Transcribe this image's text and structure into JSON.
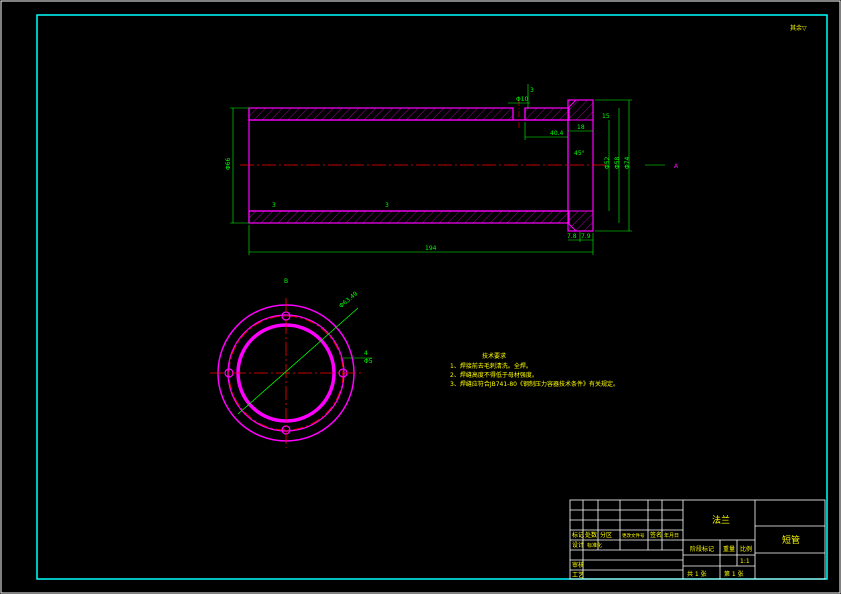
{
  "roughness_symbol": "其余▽",
  "section_label": "A",
  "dimensions": {
    "phi10": "Φ10",
    "small_3": "3",
    "d40_4": "40.4",
    "d18": "18",
    "d15": "15",
    "phi66": "Φ66",
    "phi52": "Φ52",
    "phi58": "Φ58",
    "phi74": "Φ74",
    "chamfer": "45°",
    "weld_a": "3",
    "weld_b": "3",
    "d194": "194",
    "d7_8": "7.8",
    "d7_9": "7.9",
    "circle_b": "B",
    "phi63_49": "Φ63.49",
    "side_4": "4",
    "side_phi5": "Φ5"
  },
  "tech_notes": {
    "title": "技术要求",
    "items": [
      "1、焊接前去毛刺清洗。全焊。",
      "2、焊缝高度不得低于母材强度。",
      "3、焊缝应符合JB741-80《钢制压力容器技术条件》有关规定。"
    ]
  },
  "title_block": {
    "part_name": "法兰",
    "drawing_name": "短管",
    "row_labels": [
      "标记",
      "处数",
      "分区",
      "更改文件号",
      "签名",
      "年月日"
    ],
    "designer": "设计",
    "standardize": "标准化",
    "audit": "审核",
    "process": "工艺",
    "approve": "批准",
    "stage_label": "阶段标记",
    "weight_label": "重量",
    "scale_label": "比例",
    "scale_value": "1:1",
    "sheets_total": "共 1 张",
    "sheet_no": "第 1 张"
  }
}
